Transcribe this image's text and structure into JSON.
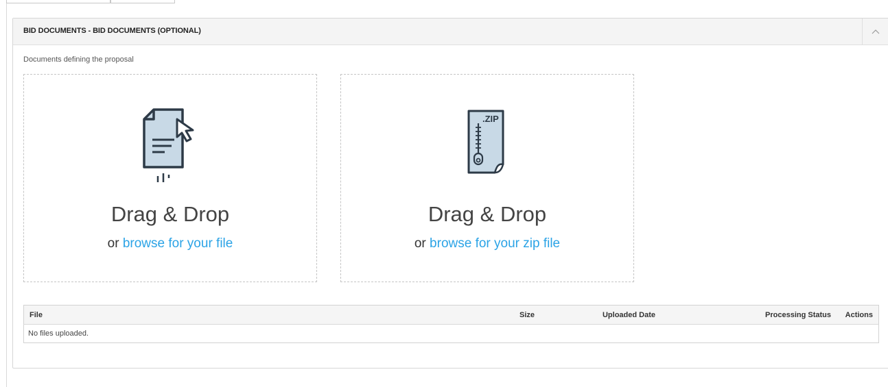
{
  "panel": {
    "title": "BID DOCUMENTS - BID DOCUMENTS (OPTIONAL)",
    "subtitle": "Documents defining the proposal"
  },
  "dropzones": [
    {
      "title": "Drag & Drop",
      "or": "or",
      "link": "browse for your file",
      "icon": "file-pointer-icon"
    },
    {
      "title": "Drag & Drop",
      "or": "or",
      "link": "browse for your zip file",
      "icon": "zip-file-icon",
      "icon_text": ".ZIP"
    }
  ],
  "table": {
    "columns": [
      "File",
      "Size",
      "Uploaded Date",
      "Processing Status",
      "Actions"
    ],
    "empty_message": "No files uploaded."
  },
  "colors": {
    "link": "#2ba3e6",
    "icon_fill": "#c8d9e6",
    "icon_stroke": "#2d3a47"
  }
}
